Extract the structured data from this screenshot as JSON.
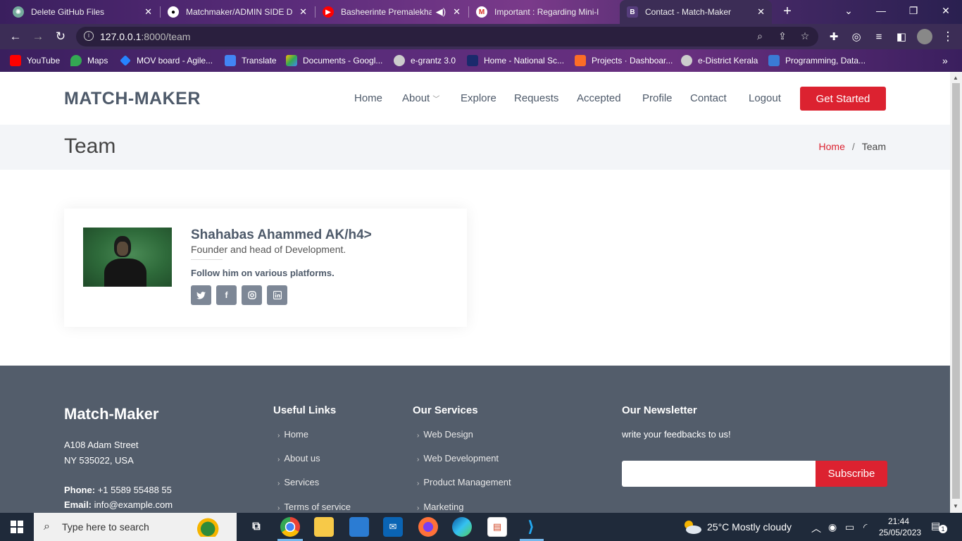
{
  "browser": {
    "tabs": [
      {
        "title": "Delete GitHub Files",
        "icon": "chatgpt-icon"
      },
      {
        "title": "Matchmaker/ADMIN SIDE D",
        "icon": "github-icon"
      },
      {
        "title": "Basheerinte Premalekha",
        "icon": "youtube-icon"
      },
      {
        "title": "Important : Regarding Mini-l",
        "icon": "gmail-icon"
      },
      {
        "title": "Contact - Match-Maker",
        "icon": "bootstrap-icon"
      }
    ],
    "url_host": "127.0.0.1",
    "url_rest": ":8000/team",
    "bookmarks": [
      {
        "label": "YouTube"
      },
      {
        "label": "Maps"
      },
      {
        "label": "MOV board - Agile..."
      },
      {
        "label": "Translate"
      },
      {
        "label": "Documents - Googl..."
      },
      {
        "label": "e-grantz 3.0"
      },
      {
        "label": "Home - National Sc..."
      },
      {
        "label": "Projects · Dashboar..."
      },
      {
        "label": "e-District Kerala"
      },
      {
        "label": "Programming, Data..."
      }
    ]
  },
  "site": {
    "logo": "MATCH-MAKER",
    "nav": {
      "home": "Home",
      "about": "About",
      "explore": "Explore",
      "requests": "Requests",
      "accepted": "Accepted",
      "profile": "Profile",
      "contact": "Contact",
      "logout": "Logout",
      "cta": "Get Started"
    },
    "breadcrumbs": {
      "title": "Team",
      "home": "Home",
      "current": "Team"
    },
    "member": {
      "name": "Shahabas Ahammed AK/h4>",
      "role": "Founder and head of Development.",
      "follow": "Follow him on various platforms."
    },
    "footer": {
      "brand": "Match-Maker",
      "address_line1": "A108 Adam Street",
      "address_line2": "NY 535022, USA",
      "phone_label": "Phone:",
      "phone": "+1 5589 55488 55",
      "email_label": "Email:",
      "email": "info@example.com",
      "useful_links_title": "Useful Links",
      "useful_links": [
        "Home",
        "About us",
        "Services",
        "Terms of service"
      ],
      "services_title": "Our Services",
      "services": [
        "Web Design",
        "Web Development",
        "Product Management",
        "Marketing"
      ],
      "newsletter_title": "Our Newsletter",
      "newsletter_text": "write your feedbacks to us!",
      "subscribe": "Subscribe"
    }
  },
  "taskbar": {
    "search_placeholder": "Type here to search",
    "weather": "25°C  Mostly cloudy",
    "time": "21:44",
    "date": "25/05/2023",
    "notifications": "1"
  },
  "colors": {
    "accent": "#dc2230",
    "text": "#4e5a6a",
    "footer_bg": "#535d6b"
  }
}
